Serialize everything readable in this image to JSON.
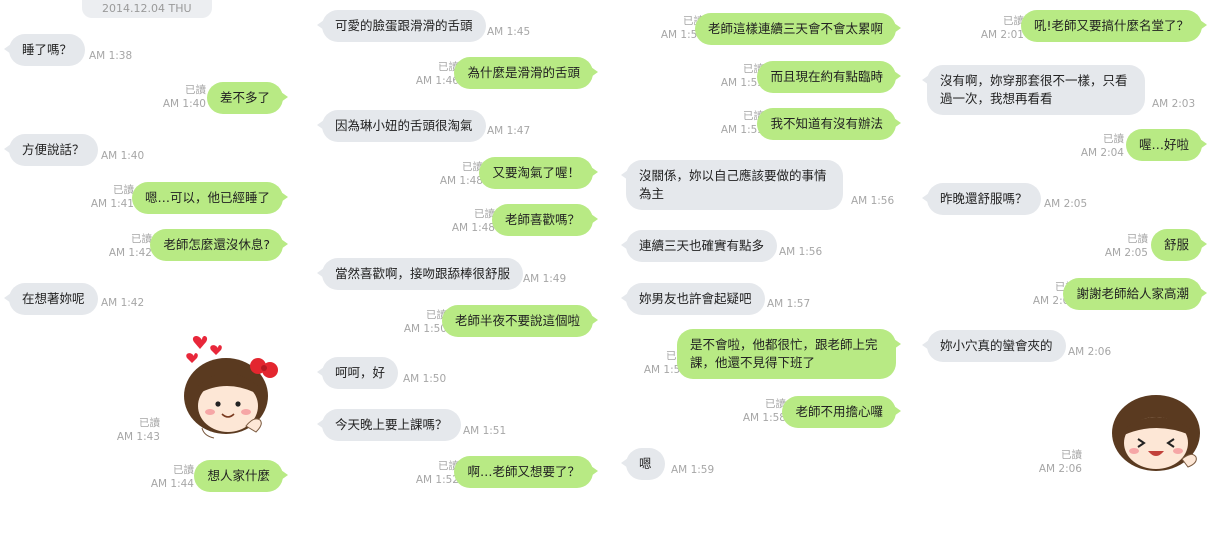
{
  "date_label": "2014.12.04 THU",
  "read_label": "已讀",
  "col1": [
    {
      "side": "them",
      "text": "睡了嗎？",
      "time": "AM 1:38"
    },
    {
      "side": "me",
      "text": "差不多了",
      "time": "AM 1:40"
    },
    {
      "side": "them",
      "text": "方便說話？",
      "time": "AM 1:40"
    },
    {
      "side": "me",
      "text": "嗯…可以，他已經睡了",
      "time": "AM 1:41"
    },
    {
      "side": "me",
      "text": "老師怎麼還沒休息?",
      "time": "AM 1:42"
    },
    {
      "side": "them",
      "text": "在想著妳呢",
      "time": "AM 1:42"
    },
    {
      "side": "me",
      "text": "",
      "time": "AM 1:43",
      "sticker": "girl-hearts-sticker"
    },
    {
      "side": "me",
      "text": "想人家什麼",
      "time": "AM 1:44"
    }
  ],
  "col2": [
    {
      "side": "them",
      "text": "可愛的臉蛋跟滑滑的舌頭",
      "time": "AM 1:45"
    },
    {
      "side": "me",
      "text": "為什麼是滑滑的舌頭",
      "time": "AM 1:46"
    },
    {
      "side": "them",
      "text": "因為琳小妞的舌頭很淘氣",
      "time": "AM 1:47"
    },
    {
      "side": "me",
      "text": "又要淘氣了喔！",
      "time": "AM 1:48"
    },
    {
      "side": "me",
      "text": "老師喜歡嗎？",
      "time": "AM 1:48"
    },
    {
      "side": "them",
      "text": "當然喜歡啊，接吻跟舔棒很舒服",
      "time": "AM 1:49"
    },
    {
      "side": "me",
      "text": "老師半夜不要說這個啦",
      "time": "AM 1:50"
    },
    {
      "side": "them",
      "text": "呵呵，好",
      "time": "AM 1:50"
    },
    {
      "side": "them",
      "text": "今天晚上要上課嗎？",
      "time": "AM 1:51"
    },
    {
      "side": "me",
      "text": "啊…老師又想要了？",
      "time": "AM 1:52"
    }
  ],
  "col3": [
    {
      "side": "me",
      "text": "老師這樣連續三天會不會太累啊",
      "time": "AM 1:54"
    },
    {
      "side": "me",
      "text": "而且現在約有點臨時",
      "time": "AM 1:55"
    },
    {
      "side": "me",
      "text": "我不知道有沒有辦法",
      "time": "AM 1:55"
    },
    {
      "side": "them",
      "text": "沒關係，妳以自己應該要做的事情為主",
      "time": "AM 1:56"
    },
    {
      "side": "them",
      "text": "連續三天也確實有點多",
      "time": "AM 1:56"
    },
    {
      "side": "them",
      "text": "妳男友也許會起疑吧",
      "time": "AM 1:57"
    },
    {
      "side": "me",
      "text": "是不會啦，他都很忙，跟老師上完課，他還不見得下班了",
      "time": "AM 1:58"
    },
    {
      "side": "me",
      "text": "老師不用擔心囉",
      "time": "AM 1:58"
    },
    {
      "side": "them",
      "text": "嗯",
      "time": "AM 1:59"
    }
  ],
  "col4": [
    {
      "side": "me",
      "text": "吼!老師又要搞什麼名堂了？",
      "time": "AM 2:01"
    },
    {
      "side": "them",
      "text": "沒有啊，妳穿那套很不一樣，只看過一次，我想再看看",
      "time": "AM 2:03"
    },
    {
      "side": "me",
      "text": "喔…好啦",
      "time": "AM 2:04"
    },
    {
      "side": "them",
      "text": "昨晚還舒服嗎？",
      "time": "AM 2:05"
    },
    {
      "side": "me",
      "text": "舒服",
      "time": "AM 2:05"
    },
    {
      "side": "me",
      "text": "謝謝老師給人家高潮",
      "time": "AM 2:05"
    },
    {
      "side": "them",
      "text": "妳小穴真的蠻會夾的",
      "time": "AM 2:06"
    },
    {
      "side": "me",
      "text": "",
      "time": "AM 2:06",
      "sticker": "girl-laughing-sticker"
    }
  ],
  "colors": {
    "my_bubble": "#b8ea84",
    "their_bubble": "#e5e8ec",
    "meta": "#a6a6a6"
  }
}
